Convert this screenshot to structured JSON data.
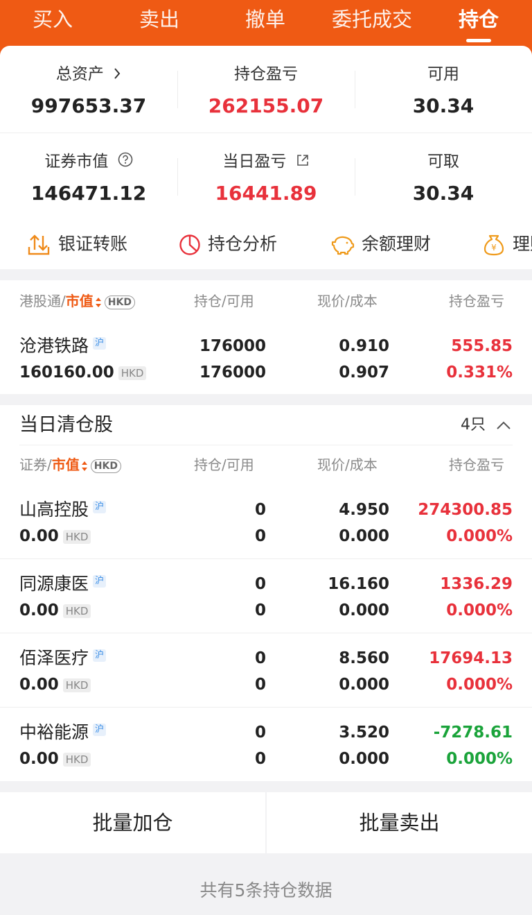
{
  "tabs": [
    {
      "label": "买入"
    },
    {
      "label": "卖出"
    },
    {
      "label": "撤单"
    },
    {
      "label": "委托成交"
    },
    {
      "label": "持仓"
    }
  ],
  "summary": {
    "total_assets_label": "总资产",
    "total_assets": "997653.37",
    "position_pnl_label": "持仓盈亏",
    "position_pnl": "262155.07",
    "available_label": "可用",
    "available": "30.34",
    "market_value_label": "证券市值",
    "market_value": "146471.12",
    "daily_pnl_label": "当日盈亏",
    "daily_pnl": "16441.89",
    "withdrawable_label": "可取",
    "withdrawable": "30.34"
  },
  "quick_actions": [
    {
      "label": "银证转账",
      "icon": "transfer-icon"
    },
    {
      "label": "持仓分析",
      "icon": "pie-chart-icon"
    },
    {
      "label": "余额理财",
      "icon": "piggy-bank-icon"
    },
    {
      "label": "理财",
      "icon": "money-bag-icon"
    }
  ],
  "holdings": {
    "header": {
      "col1_prefix": "港股通/",
      "col1_sort": "市值",
      "hkd": "HKD",
      "col2": "持仓/可用",
      "col3": "现价/成本",
      "col4": "持仓盈亏"
    },
    "rows": [
      {
        "name": "沧港铁路",
        "market": "沪",
        "market_value": "160160.00",
        "currency": "HKD",
        "position": "176000",
        "available": "176000",
        "price": "0.910",
        "cost": "0.907",
        "pnl": "555.85",
        "pnl_pct": "0.331%"
      }
    ]
  },
  "cleared": {
    "title": "当日清仓股",
    "count": "4只",
    "header": {
      "col1_prefix": "证券/",
      "col1_sort": "市值",
      "hkd": "HKD",
      "col2": "持仓/可用",
      "col3": "现价/成本",
      "col4": "持仓盈亏"
    },
    "rows": [
      {
        "name": "山高控股",
        "market": "沪",
        "market_value": "0.00",
        "currency": "HKD",
        "position": "0",
        "available": "0",
        "price": "4.950",
        "cost": "0.000",
        "pnl": "274300.85",
        "pnl_pct": "0.000%"
      },
      {
        "name": "同源康医",
        "market": "沪",
        "market_value": "0.00",
        "currency": "HKD",
        "position": "0",
        "available": "0",
        "price": "16.160",
        "cost": "0.000",
        "pnl": "1336.29",
        "pnl_pct": "0.000%"
      },
      {
        "name": "佰泽医疗",
        "market": "沪",
        "market_value": "0.00",
        "currency": "HKD",
        "position": "0",
        "available": "0",
        "price": "8.560",
        "cost": "0.000",
        "pnl": "17694.13",
        "pnl_pct": "0.000%"
      },
      {
        "name": "中裕能源",
        "market": "沪",
        "market_value": "0.00",
        "currency": "HKD",
        "position": "0",
        "available": "0",
        "price": "3.520",
        "cost": "0.000",
        "pnl": "-7278.61",
        "pnl_pct": "0.000%"
      }
    ]
  },
  "buttons": {
    "batch_add": "批量加仓",
    "batch_sell": "批量卖出"
  },
  "footer": {
    "total_text": "共有5条持仓数据"
  },
  "colors": {
    "brand": "#ef5a14",
    "up": "#e8313b",
    "down": "#1aa33a"
  }
}
